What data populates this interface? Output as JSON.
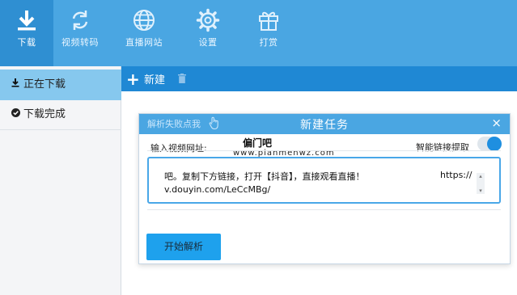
{
  "toolbar": {
    "items": [
      {
        "label": "下载",
        "icon": "download-icon",
        "active": true
      },
      {
        "label": "视频转码",
        "icon": "convert-icon",
        "active": false
      },
      {
        "label": "直播网站",
        "icon": "globe-icon",
        "active": false
      },
      {
        "label": "设置",
        "icon": "gear-icon",
        "active": false
      },
      {
        "label": "打赏",
        "icon": "gift-icon",
        "active": false
      }
    ]
  },
  "sidebar": {
    "items": [
      {
        "label": "正在下载",
        "icon": "download-small-icon",
        "active": true
      },
      {
        "label": "下载完成",
        "icon": "check-circle-icon",
        "active": false
      }
    ]
  },
  "actionbar": {
    "new_label": "新建",
    "trash_icon": "trash-icon"
  },
  "dialog": {
    "hint": "解析失败点我",
    "title": "新建任务",
    "close": "×",
    "url_label": "输入视频网址:",
    "watermark_top": "偏门吧",
    "watermark_bottom": "www.pianmenwz.com",
    "smart_label": "智能链接提取",
    "smart_enabled": true,
    "url_text_line1": "吧。复制下方链接，打开【抖音】，直接观看直播！",
    "url_text_right": "https://",
    "url_text_line2": "v.douyin.com/LeCcMBg/",
    "start_button": "开始解析"
  },
  "colors": {
    "toolbar": "#4aa6e2",
    "toolbar_active": "#2f8fd2",
    "actionbar": "#1f88d4",
    "accent": "#1ea1ed",
    "sidebar_active": "#86c8ee"
  }
}
